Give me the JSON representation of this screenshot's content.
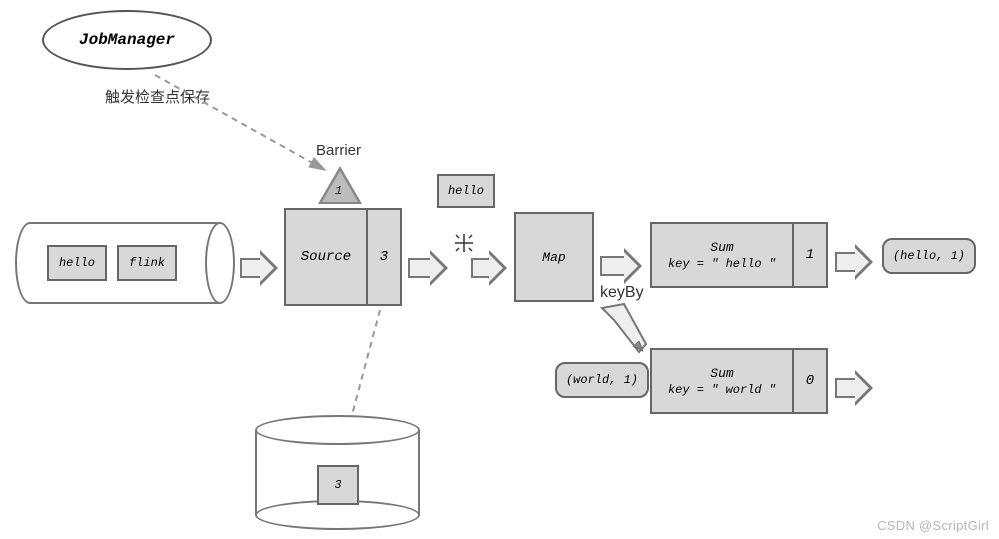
{
  "jobmanager": {
    "label": "JobManager"
  },
  "trigger_label": "触发检查点保存",
  "barrier": {
    "label": "Barrier",
    "id": "1"
  },
  "queue": {
    "items": [
      "hello",
      "flink"
    ]
  },
  "source": {
    "label": "Source",
    "state": "3"
  },
  "inflight": {
    "label": "hello"
  },
  "map": {
    "label": "Map"
  },
  "keyby_label": "keyBy",
  "sum1": {
    "title": "Sum",
    "sub": "key = \" hello \"",
    "state": "1"
  },
  "sum2": {
    "title": "Sum",
    "sub": "key = \" world \"",
    "state": "0"
  },
  "out1": "(hello, 1)",
  "out2": "(world, 1)",
  "storage": {
    "value": "3"
  },
  "watermark": "CSDN @ScriptGirl",
  "colors": {
    "fill": "#d8d8d8",
    "stroke": "#666"
  }
}
